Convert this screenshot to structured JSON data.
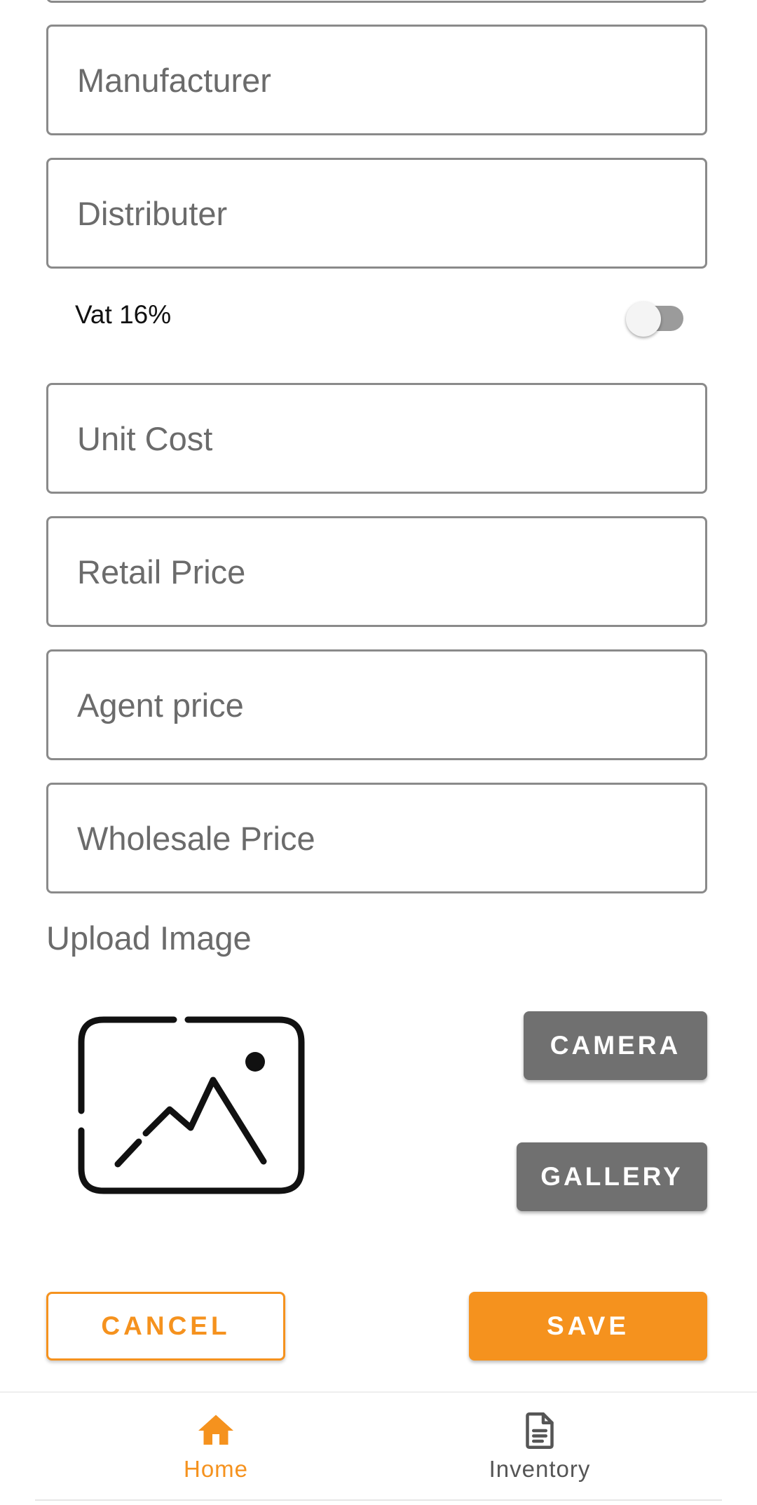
{
  "form": {
    "manufacturer_placeholder": "Manufacturer",
    "distributer_placeholder": "Distributer",
    "vat_label": "Vat 16%",
    "vat_enabled": false,
    "unit_cost_placeholder": "Unit Cost",
    "retail_price_placeholder": "Retail Price",
    "agent_price_placeholder": "Agent price",
    "wholesale_price_placeholder": "Wholesale Price"
  },
  "upload": {
    "label": "Upload Image",
    "camera_label": "CAMERA",
    "gallery_label": "GALLERY",
    "image_icon": "image-placeholder-icon"
  },
  "actions": {
    "cancel_label": "CANCEL",
    "save_label": "SAVE"
  },
  "bottom_nav": {
    "items": [
      {
        "label": "Home",
        "icon": "home-icon",
        "active": true
      },
      {
        "label": "Inventory",
        "icon": "document-icon",
        "active": false
      }
    ]
  },
  "colors": {
    "accent": "#f5921e",
    "secondary_button": "#707070",
    "field_border": "#8a8a8a",
    "placeholder_text": "#6b6b6b"
  }
}
